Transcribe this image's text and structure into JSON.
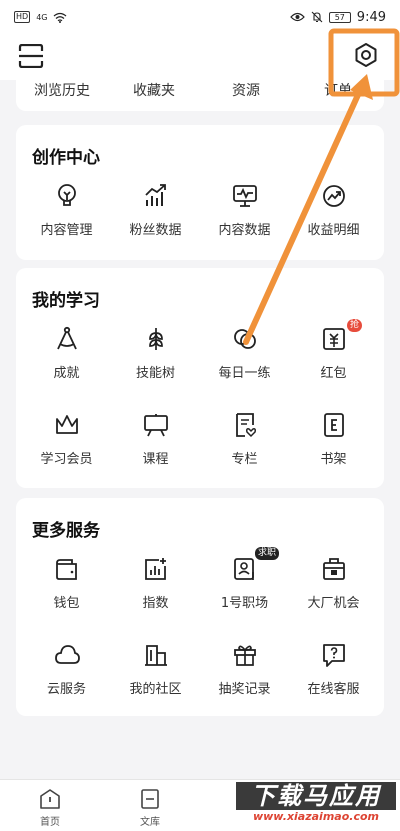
{
  "status_bar": {
    "hd": "HD",
    "signal": "4G",
    "battery": "57",
    "time": "9:49"
  },
  "quick_links": [
    "浏览历史",
    "收藏夹",
    "资源",
    "订单"
  ],
  "creation": {
    "title": "创作中心",
    "items": [
      {
        "label": "内容管理",
        "icon": "lightbulb-icon"
      },
      {
        "label": "粉丝数据",
        "icon": "growth-chart-icon"
      },
      {
        "label": "内容数据",
        "icon": "monitor-chart-icon"
      },
      {
        "label": "收益明细",
        "icon": "earnings-icon"
      }
    ]
  },
  "learning": {
    "title": "我的学习",
    "items": [
      {
        "label": "成就",
        "icon": "compass-icon"
      },
      {
        "label": "技能树",
        "icon": "wheat-icon"
      },
      {
        "label": "每日一练",
        "icon": "circles-icon"
      },
      {
        "label": "红包",
        "icon": "red-packet-icon",
        "tag": "抢"
      },
      {
        "label": "学习会员",
        "icon": "crown-icon"
      },
      {
        "label": "课程",
        "icon": "presentation-board-icon"
      },
      {
        "label": "专栏",
        "icon": "column-icon"
      },
      {
        "label": "书架",
        "icon": "bookshelf-icon"
      }
    ]
  },
  "services": {
    "title": "更多服务",
    "items": [
      {
        "label": "钱包",
        "icon": "wallet-icon"
      },
      {
        "label": "指数",
        "icon": "index-chart-icon"
      },
      {
        "label": "1号职场",
        "icon": "id-badge-icon",
        "tag": "求职"
      },
      {
        "label": "大厂机会",
        "icon": "briefcase-icon"
      },
      {
        "label": "云服务",
        "icon": "cloud-icon"
      },
      {
        "label": "我的社区",
        "icon": "community-icon"
      },
      {
        "label": "抽奖记录",
        "icon": "gift-icon"
      },
      {
        "label": "在线客服",
        "icon": "chat-help-icon"
      }
    ]
  },
  "bottom_nav": [
    {
      "label": "首页",
      "icon": "home-icon"
    },
    {
      "label": "文库",
      "icon": "library-icon"
    }
  ],
  "watermark": {
    "title": "下载马应用",
    "url": "www.xiazaimao.com"
  },
  "accent_colors": {
    "annotation": "#f0923a",
    "tag": "#e74c3c"
  }
}
